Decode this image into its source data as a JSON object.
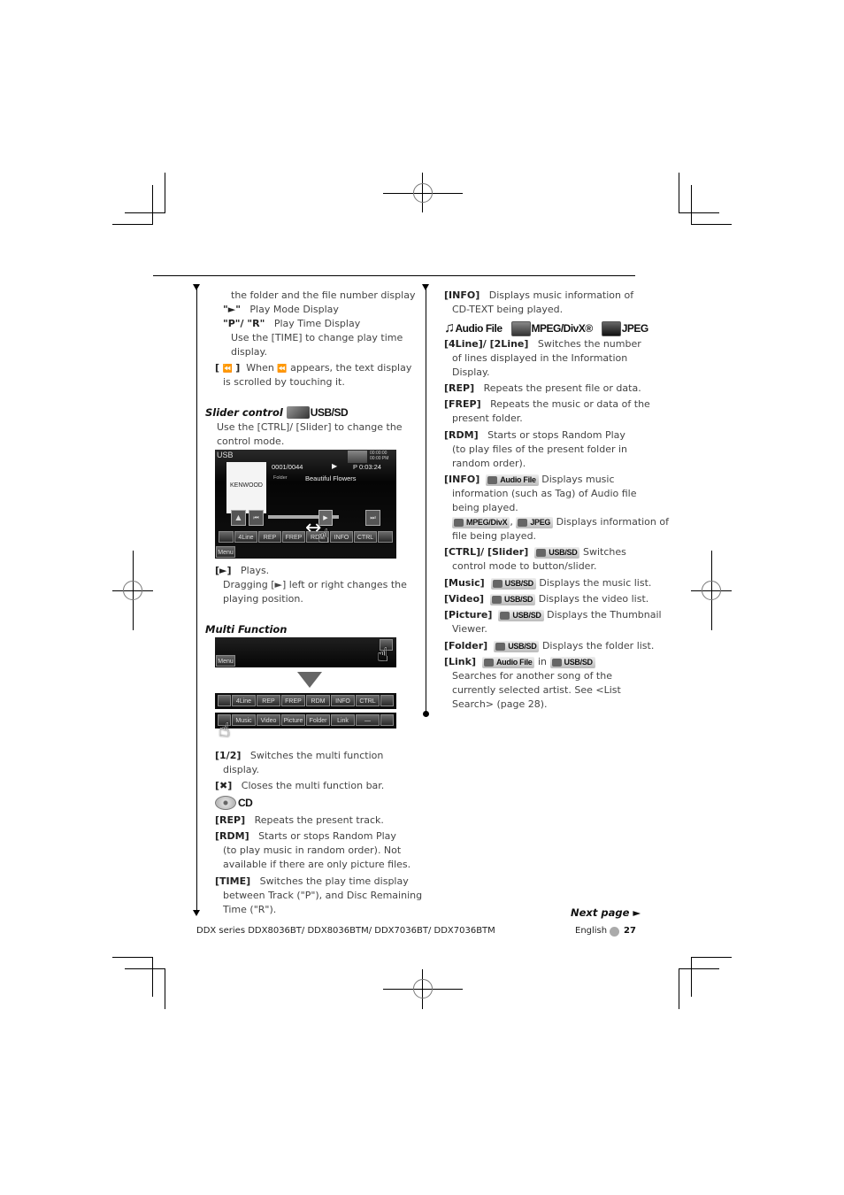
{
  "left_column": {
    "intro_lines": [
      "the folder and the file number display"
    ],
    "items_top": [
      {
        "key": "\"►\"",
        "desc": "Play Mode Display"
      },
      {
        "key": "\"P\"/ \"R\"",
        "desc": "Play Time Display"
      }
    ],
    "time_note": [
      "Use the [TIME] to change play time",
      "display."
    ],
    "scroll_item": {
      "key_open": "[",
      "key_close": "]",
      "desc1": "When",
      "desc2": "appears, the text display",
      "desc3": "is scrolled by touching it."
    },
    "slider_section": {
      "title": "Slider control",
      "badge": "USB/SD",
      "desc": [
        "Use the [CTRL]/ [Slider] to change the",
        "control mode."
      ],
      "screen": {
        "source": "USB",
        "brand": "KENWOOD",
        "track_counter": "0001/0044",
        "play_mode": "▶",
        "play_time": "P  0:03:24",
        "folder_label": "Folder",
        "folder_name": "Beautiful Flowers",
        "clock": "00:00:00\n00:00 PM",
        "buttons": [
          "4Line",
          "REP",
          "FREP",
          "RDM",
          "INFO",
          "CTRL"
        ],
        "menu": "Menu"
      },
      "play_item": {
        "key": "[►]",
        "desc": "Plays.",
        "more": [
          "Dragging [►] left or right changes the",
          "playing position."
        ]
      }
    },
    "multi_section": {
      "title": "Multi Function",
      "menu": "Menu",
      "bar1": [
        "4Line",
        "REP",
        "FREP",
        "RDM",
        "INFO",
        "CTRL"
      ],
      "bar2": [
        "Music",
        "Video",
        "Picture",
        "Folder",
        "Link",
        "—"
      ],
      "items": [
        {
          "key": "[1/2]",
          "desc": [
            "Switches the multi function",
            "display."
          ]
        },
        {
          "key": "[✖]",
          "desc": [
            "Closes the multi function bar."
          ]
        }
      ],
      "cd_badge": "CD",
      "cd_items": [
        {
          "key": "[REP]",
          "desc": [
            "Repeats the present track."
          ]
        },
        {
          "key": "[RDM]",
          "desc": [
            "Starts or stops Random Play",
            "(to play music in random order). Not",
            "available if there are only picture files."
          ]
        },
        {
          "key": "[TIME]",
          "desc": [
            "Switches the play time display",
            "between Track (\"P\"), and Disc Remaining",
            "Time (\"R\")."
          ]
        }
      ]
    }
  },
  "right_column": {
    "info_cd": {
      "key": "[INFO]",
      "desc": [
        "Displays music information of",
        "CD-TEXT being played."
      ]
    },
    "badges": [
      "Audio File",
      "MPEG/DivX®",
      "JPEG"
    ],
    "items": [
      {
        "key": "[4Line]/ [2Line]",
        "desc": [
          "Switches the number",
          "of lines displayed in the Information",
          "Display."
        ]
      },
      {
        "key": "[REP]",
        "desc": [
          "Repeats the present file or data."
        ]
      },
      {
        "key": "[FREP]",
        "desc": [
          "Repeats the music or data of the",
          "present folder."
        ]
      },
      {
        "key": "[RDM]",
        "desc": [
          "Starts or stops Random Play",
          "(to play files of the present folder in",
          "random order)."
        ]
      }
    ],
    "info_file": {
      "key": "[INFO]",
      "badge": "Audio File",
      "desc": [
        "Displays music",
        "information (such as Tag) of Audio file",
        "being played."
      ],
      "badge2": "MPEG/DivX",
      "badge3": "JPEG",
      "desc2": [
        "Displays information of",
        "file being played."
      ]
    },
    "ctrl": {
      "key": "[CTRL]/ [Slider]",
      "badge": "USB/SD",
      "desc": [
        "Switches",
        "control mode to button/slider."
      ]
    },
    "lists": [
      {
        "key": "[Music]",
        "badge": "USB/SD",
        "desc": [
          "Displays the music list."
        ]
      },
      {
        "key": "[Video]",
        "badge": "USB/SD",
        "desc": [
          "Displays the video list."
        ]
      },
      {
        "key": "[Picture]",
        "badge": "USB/SD",
        "desc": [
          "Displays the Thumbnail",
          "Viewer."
        ]
      },
      {
        "key": "[Folder]",
        "badge": "USB/SD",
        "desc": [
          "Displays the folder list."
        ]
      }
    ],
    "link": {
      "key": "[Link]",
      "badge": "Audio File",
      "in": "in",
      "badge2": "USB/SD",
      "desc": [
        "Searches for another song of the",
        "currently selected artist. See <List",
        "Search> (page 28)."
      ]
    }
  },
  "footer": {
    "next_page": "Next page ►",
    "series": "DDX series   DDX8036BT/ DDX8036BTM/ DDX7036BT/ DDX7036BTM",
    "language": "English",
    "page_number": "27"
  }
}
